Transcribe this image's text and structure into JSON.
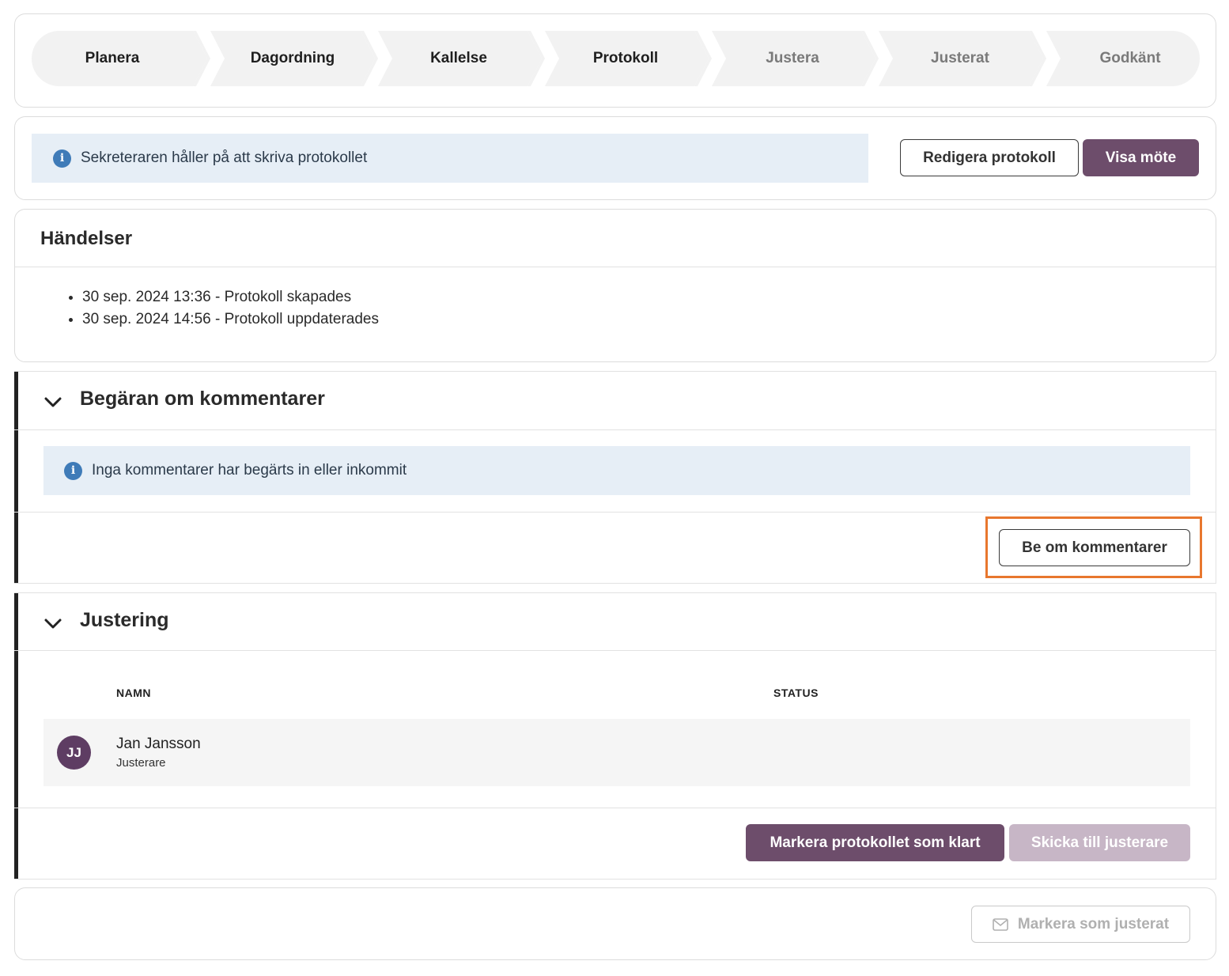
{
  "stepper": {
    "steps": [
      {
        "label": "Planera",
        "disabled": false
      },
      {
        "label": "Dagordning",
        "disabled": false
      },
      {
        "label": "Kallelse",
        "disabled": false
      },
      {
        "label": "Protokoll",
        "disabled": false
      },
      {
        "label": "Justera",
        "disabled": true
      },
      {
        "label": "Justerat",
        "disabled": true
      },
      {
        "label": "Godkänt",
        "disabled": true
      }
    ]
  },
  "status": {
    "info_text": "Sekreteraren håller på att skriva protokollet",
    "edit_button": "Redigera protokoll",
    "view_button": "Visa möte"
  },
  "events": {
    "title": "Händelser",
    "items": [
      "30 sep. 2024 13:36 - Protokoll skapades",
      "30 sep. 2024 14:56 - Protokoll uppdaterades"
    ]
  },
  "comments": {
    "title": "Begäran om kommentarer",
    "info_text": "Inga kommentarer har begärts in eller inkommit",
    "request_button": "Be om kommentarer"
  },
  "justering": {
    "title": "Justering",
    "columns": [
      "NAMN",
      "STATUS"
    ],
    "rows": [
      {
        "initials": "JJ",
        "name": "Jan Jansson",
        "role": "Justerare",
        "status": ""
      }
    ],
    "mark_done_button": "Markera protokollet som klart",
    "send_button": "Skicka till justerare"
  },
  "footer": {
    "mark_adjusted_button": "Markera som justerat"
  },
  "colors": {
    "primary": "#6d4d6b",
    "primary_disabled": "#c7b6c6",
    "info_bg": "#e6eef6",
    "info_icon": "#3f7bb8",
    "highlight": "#e8772e",
    "avatar": "#5e3d63"
  }
}
